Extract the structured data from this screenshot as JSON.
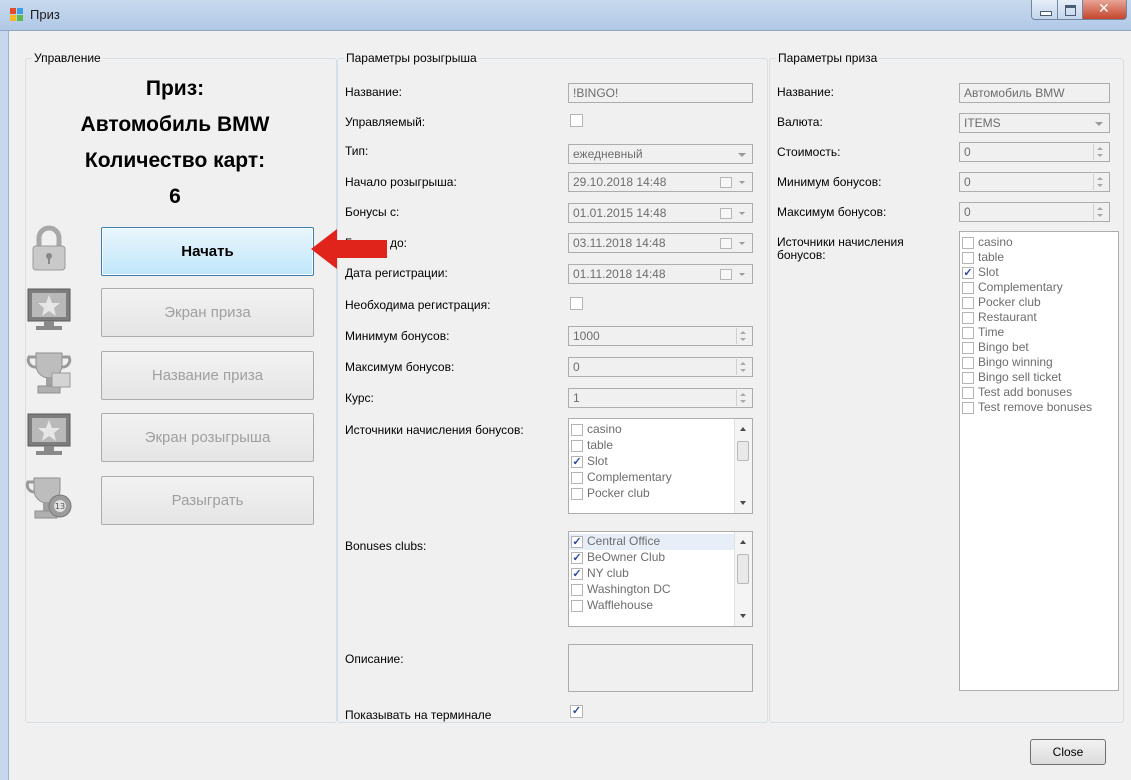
{
  "window": {
    "title": "Приз",
    "close_button": "Close"
  },
  "control": {
    "legend": "Управление",
    "prize_heading": "Приз:",
    "prize_name": "Автомобиль BMW",
    "cards_heading": "Количество карт:",
    "cards_count": "6",
    "buttons": {
      "start": "Начать",
      "prize_screen": "Экран приза",
      "prize_title": "Название приза",
      "draw_screen": "Экран розыгрыша",
      "draw": "Разыграть"
    }
  },
  "draw": {
    "legend": "Параметры розыгрыша",
    "labels": {
      "name": "Название:",
      "managed": "Управляемый:",
      "type": "Тип:",
      "start": "Начало розыгрыша:",
      "bonus_from": "Бонусы с:",
      "bonus_to": "Бонусы до:",
      "reg_date": "Дата регистрации:",
      "reg_required": "Необходима регистрация:",
      "min_bonus": "Минимум бонусов:",
      "max_bonus": "Максимум бонусов:",
      "rate": "Курс:",
      "sources": "Источники начисления бонусов:",
      "clubs": "Bonuses clubs:",
      "description": "Описание:",
      "show_terminal": "Показывать на терминале"
    },
    "values": {
      "name": "!BINGO!",
      "type": "ежедневный",
      "start": "29.10.2018 14:48",
      "bonus_from": "01.01.2015 14:48",
      "bonus_to": "03.11.2018 14:48",
      "reg_date": "01.11.2018 14:48",
      "min_bonus": "1000",
      "max_bonus": "0",
      "rate": "1"
    },
    "sources": [
      {
        "label": "casino",
        "checked": false
      },
      {
        "label": "table",
        "checked": false
      },
      {
        "label": "Slot",
        "checked": true
      },
      {
        "label": "Complementary",
        "checked": false
      },
      {
        "label": "Pocker club",
        "checked": false
      }
    ],
    "clubs": [
      {
        "label": "Central Office",
        "checked": true
      },
      {
        "label": "BeOwner Club",
        "checked": true
      },
      {
        "label": "NY club",
        "checked": true
      },
      {
        "label": "Washington DC",
        "checked": false
      },
      {
        "label": "Wafflehouse",
        "checked": false
      }
    ],
    "show_terminal_checked": true
  },
  "prize": {
    "legend": "Параметры приза",
    "labels": {
      "name": "Название:",
      "currency": "Валюта:",
      "cost": "Стоимость:",
      "min_bonus": "Минимум бонусов:",
      "max_bonus": "Максимум бонусов:",
      "sources": "Источники начисления бонусов:"
    },
    "values": {
      "name": "Автомобиль BMW",
      "currency": "ITEMS",
      "cost": "0",
      "min_bonus": "0",
      "max_bonus": "0"
    },
    "sources": [
      {
        "label": "casino",
        "checked": false
      },
      {
        "label": "table",
        "checked": false
      },
      {
        "label": "Slot",
        "checked": true
      },
      {
        "label": "Complementary",
        "checked": false
      },
      {
        "label": "Pocker club",
        "checked": false
      },
      {
        "label": "Restaurant",
        "checked": false
      },
      {
        "label": "Time",
        "checked": false
      },
      {
        "label": "Bingo bet",
        "checked": false
      },
      {
        "label": "Bingo winning",
        "checked": false
      },
      {
        "label": "Bingo sell ticket",
        "checked": false
      },
      {
        "label": "Test add bonuses",
        "checked": false
      },
      {
        "label": "Test remove bonuses",
        "checked": false
      }
    ]
  },
  "icons": {
    "app": "app-window-icon",
    "lock": "lock-icon",
    "screen": "monitor-star-icon",
    "trophy": "trophy-icon",
    "lottery": "lottery-ball-icon",
    "arrow": "red-arrow-icon"
  },
  "colors": {
    "arrow": "#e0241b",
    "active_button": "#bfe6f9",
    "title_bar": "#b0c8e6"
  }
}
